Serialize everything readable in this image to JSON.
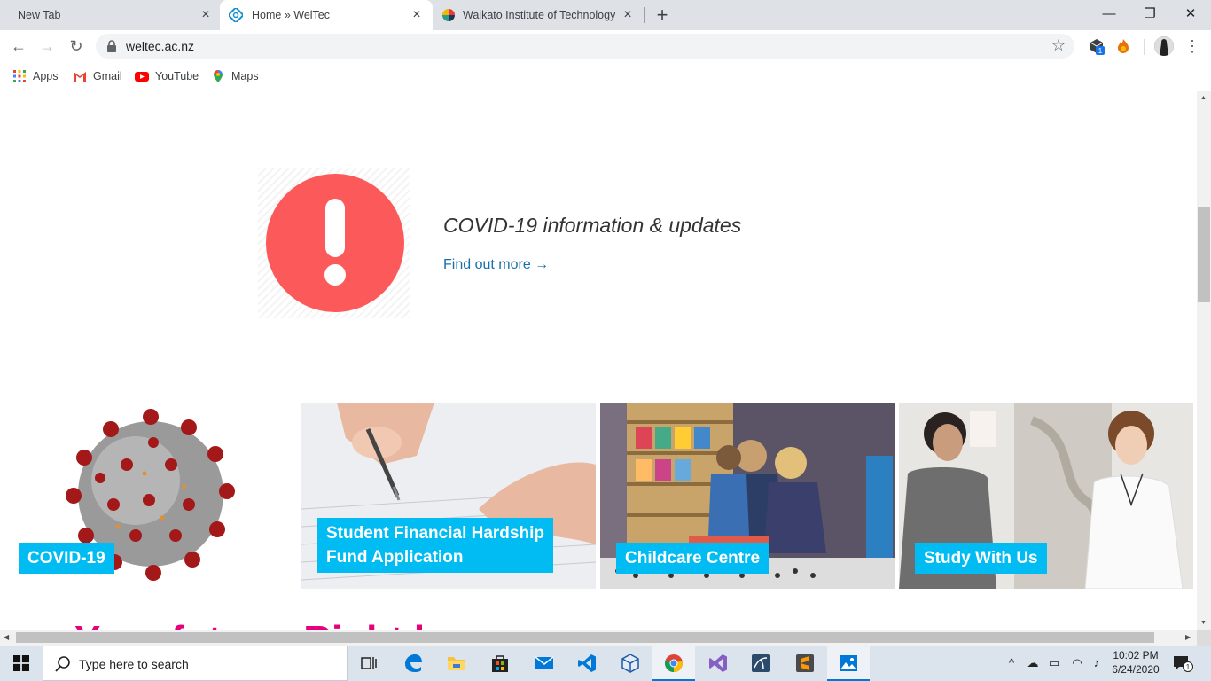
{
  "browser": {
    "tabs": [
      {
        "title": "New Tab",
        "active": false
      },
      {
        "title": "Home » WelTec",
        "active": true
      },
      {
        "title": "Waikato Institute of Technology",
        "active": false
      }
    ],
    "url": "weltec.ac.nz",
    "bookmarks": [
      "Apps",
      "Gmail",
      "YouTube",
      "Maps"
    ],
    "extension_badge": "1",
    "colors": {
      "tab_strip": "#dee1e6",
      "active_tab": "#ffffff"
    }
  },
  "page": {
    "covid_heading": "COVID-19 information & updates",
    "covid_link": "Find out more →",
    "cards": [
      {
        "label_lines": [
          "COVID-19"
        ]
      },
      {
        "label_lines": [
          "Student Financial Hardship",
          "Fund Application"
        ]
      },
      {
        "label_lines": [
          "Childcare Centre"
        ]
      },
      {
        "label_lines": [
          "Study With Us"
        ]
      }
    ],
    "tagline_partial": "Your future. Right here.",
    "colors": {
      "alert": "#fc5a5a",
      "card_label_bg": "#00bcf2",
      "link": "#1a6fa8",
      "tagline": "#e5007e"
    }
  },
  "taskbar": {
    "search_placeholder": "Type here to search",
    "time": "10:02 PM",
    "date": "6/24/2020",
    "notification_count": "1",
    "pinned": [
      "task-view",
      "edge",
      "file-explorer",
      "store",
      "mail",
      "vscode",
      "virtualbox",
      "chrome",
      "visual-studio",
      "mysql-workbench",
      "sublime-text",
      "photos"
    ]
  }
}
